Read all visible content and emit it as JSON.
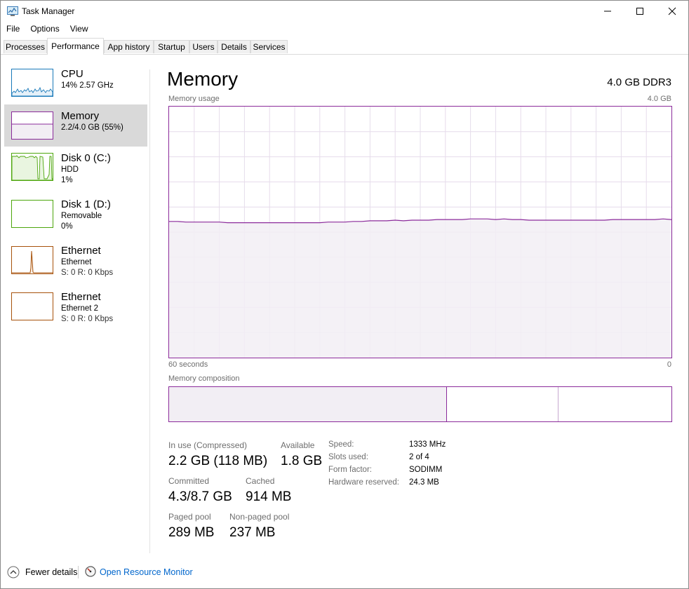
{
  "window": {
    "title": "Task Manager"
  },
  "menu": [
    "File",
    "Options",
    "View"
  ],
  "tabs": [
    "Processes",
    "Performance",
    "App history",
    "Startup",
    "Users",
    "Details",
    "Services"
  ],
  "active_tab": "Performance",
  "sidebar": [
    {
      "title": "CPU",
      "sub1": "14%  2.57 GHz",
      "sub2": "",
      "sub3": "",
      "color": "#1979b9"
    },
    {
      "title": "Memory",
      "sub1": "2.2/4.0 GB (55%)",
      "sub2": "",
      "sub3": "",
      "color": "#8b2b9b"
    },
    {
      "title": "Disk 0 (C:)",
      "sub1": "HDD",
      "sub2": "1%",
      "sub3": "",
      "color": "#4da60c"
    },
    {
      "title": "Disk 1 (D:)",
      "sub1": "Removable",
      "sub2": "0%",
      "sub3": "",
      "color": "#4da60c"
    },
    {
      "title": "Ethernet",
      "sub1": "Ethernet",
      "sub2": "S: 0  R: 0 Kbps",
      "sub3": "",
      "color": "#a7520b"
    },
    {
      "title": "Ethernet",
      "sub1": "Ethernet 2",
      "sub2": "S: 0  R: 0 Kbps",
      "sub3": "",
      "color": "#a7520b"
    }
  ],
  "main": {
    "title": "Memory",
    "spec": "4.0 GB DDR3",
    "usage_label": "Memory usage",
    "usage_max": "4.0 GB",
    "time_left": "60 seconds",
    "time_right": "0",
    "composition_label": "Memory composition",
    "composition": {
      "in_use_fraction": 0.552,
      "modified_fraction": 0.22,
      "standby_fraction": 0.228
    }
  },
  "stats": {
    "in_use_label": "In use (Compressed)",
    "in_use_value": "2.2 GB (118 MB)",
    "available_label": "Available",
    "available_value": "1.8 GB",
    "committed_label": "Committed",
    "committed_value": "4.3/8.7 GB",
    "cached_label": "Cached",
    "cached_value": "914 MB",
    "paged_label": "Paged pool",
    "paged_value": "289 MB",
    "nonpaged_label": "Non-paged pool",
    "nonpaged_value": "237 MB"
  },
  "hardware": [
    {
      "label": "Speed:",
      "value": "1333 MHz"
    },
    {
      "label": "Slots used:",
      "value": "2 of 4"
    },
    {
      "label": "Form factor:",
      "value": "SODIMM"
    },
    {
      "label": "Hardware reserved:",
      "value": "24.3 MB"
    }
  ],
  "footer": {
    "fewer_details": "Fewer details",
    "resource_monitor": "Open Resource Monitor"
  },
  "chart_data": {
    "type": "area",
    "title": "Memory usage",
    "xlabel": "",
    "ylabel": "",
    "x_range_seconds": [
      60,
      0
    ],
    "ylim": [
      0,
      4.0
    ],
    "unit": "GB",
    "color": "#8b2b9b",
    "series": [
      {
        "values": [
          2.17,
          2.17,
          2.16,
          2.16,
          2.16,
          2.16,
          2.16,
          2.15,
          2.15,
          2.15,
          2.15,
          2.15,
          2.15,
          2.15,
          2.15,
          2.15,
          2.15,
          2.15,
          2.15,
          2.16,
          2.16,
          2.16,
          2.17,
          2.17,
          2.18,
          2.18,
          2.18,
          2.19,
          2.18,
          2.19,
          2.19,
          2.19,
          2.2,
          2.2,
          2.2,
          2.2,
          2.21,
          2.21,
          2.21,
          2.2,
          2.21,
          2.2,
          2.2,
          2.19,
          2.19,
          2.19,
          2.19,
          2.19,
          2.19,
          2.19,
          2.19,
          2.19,
          2.19,
          2.2,
          2.2,
          2.2,
          2.2,
          2.2,
          2.2,
          2.21,
          2.2
        ]
      }
    ]
  }
}
